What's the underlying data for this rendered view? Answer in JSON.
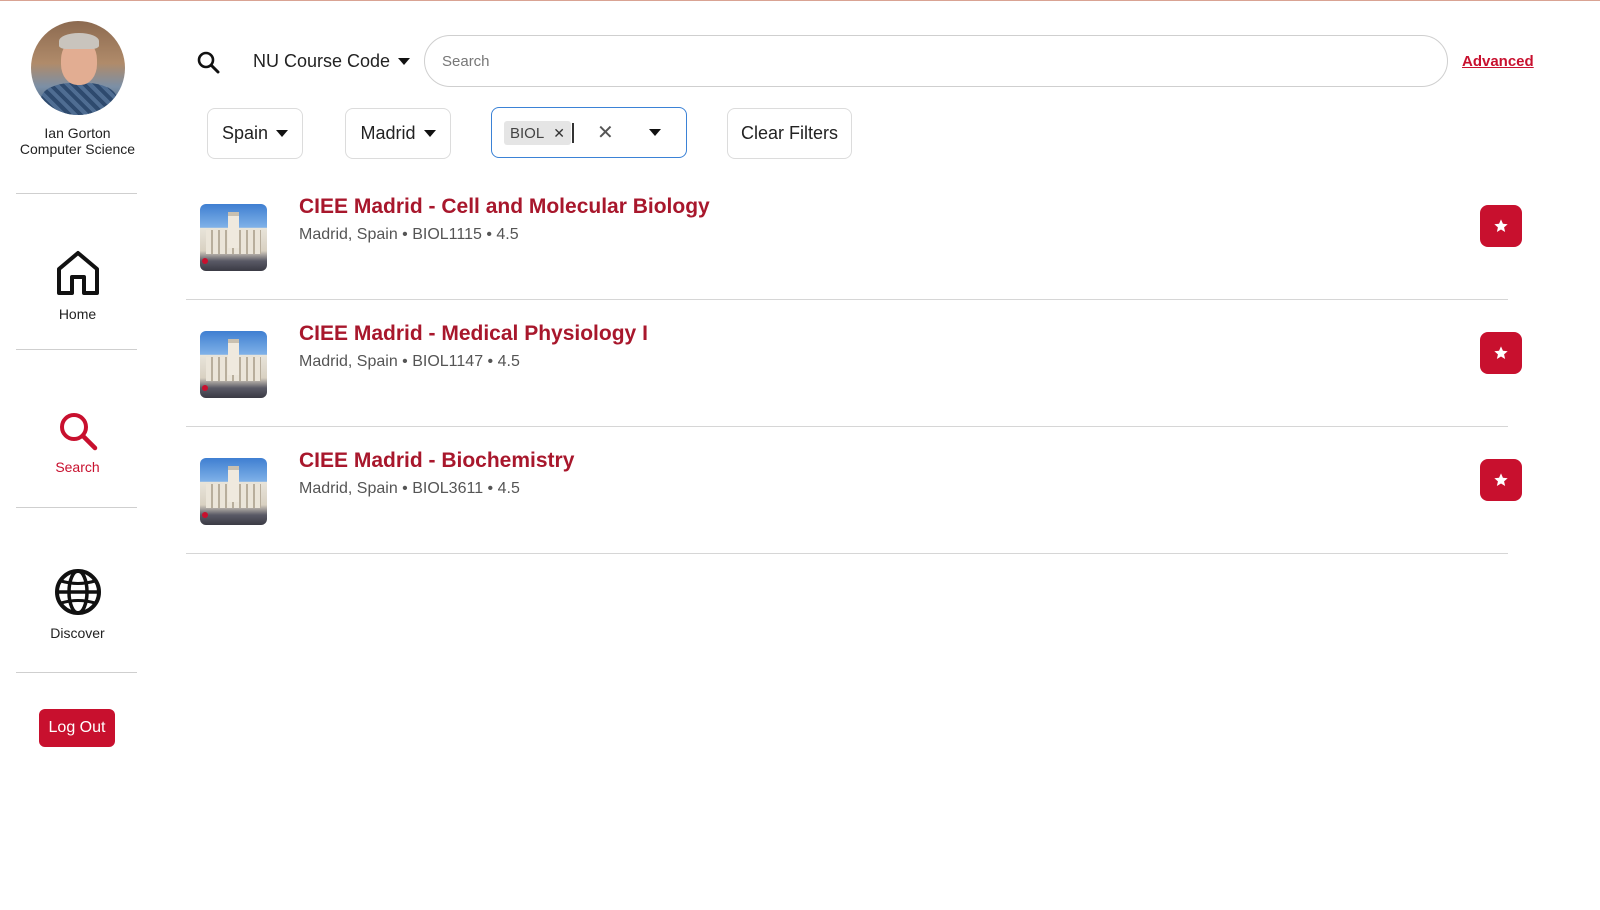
{
  "profile": {
    "name": "Ian Gorton",
    "department": "Computer Science"
  },
  "nav": {
    "home": "Home",
    "search": "Search",
    "discover": "Discover",
    "logout": "Log Out"
  },
  "search": {
    "code_select": "NU Course Code",
    "placeholder": "Search",
    "value": "",
    "advanced": "Advanced"
  },
  "filters": {
    "country": "Spain",
    "city": "Madrid",
    "subject_chips": [
      "BIOL"
    ],
    "clear": "Clear Filters"
  },
  "results": [
    {
      "title": "CIEE Madrid - Cell and Molecular Biology",
      "location": "Madrid, Spain",
      "code": "BIOL1115",
      "credits": "4.5"
    },
    {
      "title": "CIEE Madrid - Medical Physiology I",
      "location": "Madrid, Spain",
      "code": "BIOL1147",
      "credits": "4.5"
    },
    {
      "title": "CIEE Madrid - Biochemistry",
      "location": "Madrid, Spain",
      "code": "BIOL3611",
      "credits": "4.5"
    }
  ],
  "colors": {
    "accent": "#c8102e",
    "title_red": "#a8172c",
    "focus_blue": "#3b82d6"
  },
  "icons": {
    "search_top": "search-icon",
    "home": "home-icon",
    "search_nav": "search-icon",
    "discover": "globe-icon",
    "favorite": "star-icon"
  }
}
